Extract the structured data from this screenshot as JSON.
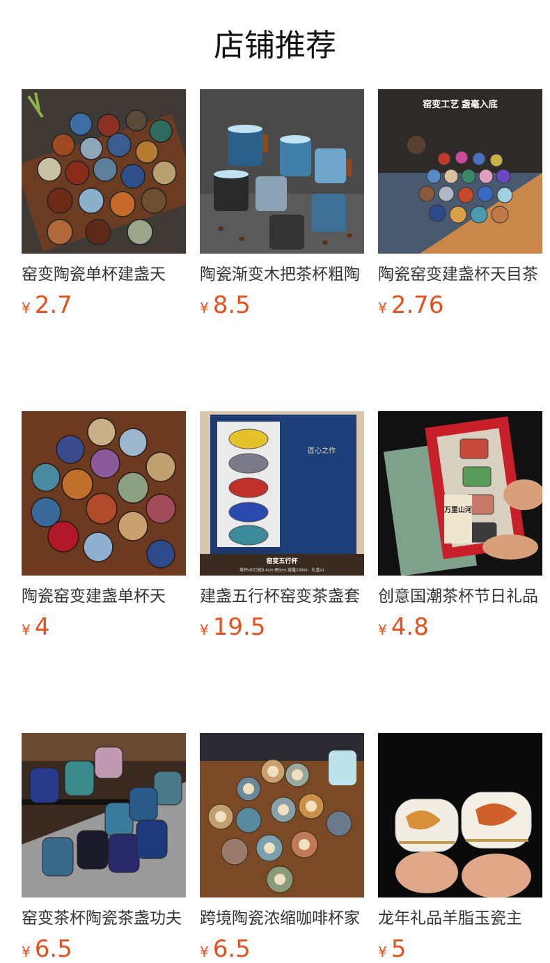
{
  "page": {
    "title": "店铺推荐"
  },
  "currency_symbol": "¥",
  "products": [
    {
      "name": "窑变陶瓷单杯建盏天",
      "price": "2.7"
    },
    {
      "name": "陶瓷渐变木把茶杯粗陶",
      "price": "8.5"
    },
    {
      "name": "陶瓷窑变建盏杯天目茶",
      "price": "2.76"
    },
    {
      "name": "陶瓷窑变建盏单杯天",
      "price": "4"
    },
    {
      "name": "建盏五行杯窑变茶盏套",
      "price": "19.5"
    },
    {
      "name": "创意国潮茶杯节日礼品",
      "price": "4.8"
    },
    {
      "name": "窑变茶杯陶瓷茶盏功夫",
      "price": "6.5"
    },
    {
      "name": "跨境陶瓷浓缩咖啡杯家",
      "price": "6.5"
    },
    {
      "name": "龙年礼品羊脂玉瓷主",
      "price": "5"
    }
  ],
  "image_text": {
    "p3_banner_title": "窑变工艺 盏毫入底",
    "p5_box_label": "窑变五行杯",
    "p5_box_spec": "茶杯x5/口径8.4cm 高5cm 容量100ml、礼盒x1",
    "p5_box_lid": "匠心之作",
    "p6_box_label": "万里山河"
  }
}
